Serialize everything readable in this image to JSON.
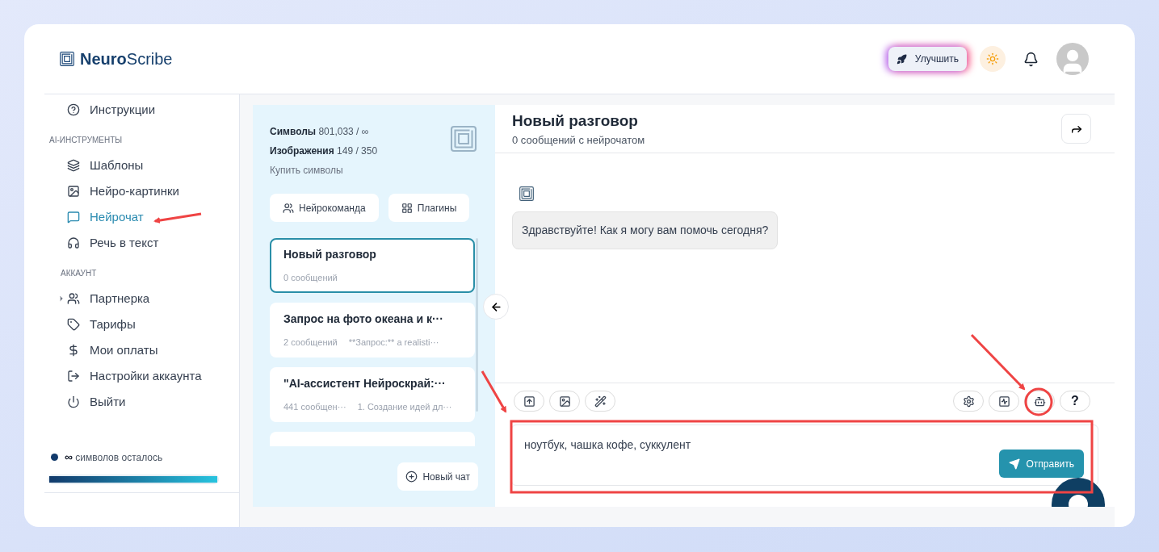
{
  "brand": {
    "bold": "Neuro",
    "light": "Scribe"
  },
  "topbar": {
    "upgrade": "Улучшить"
  },
  "sidebar": {
    "sections": [
      {
        "items": [
          {
            "kind": "link",
            "label": "Инструкции",
            "selected": false
          }
        ]
      },
      {
        "heading": "AI-ИНСТРУМЕНТЫ",
        "items": [
          {
            "kind": "link",
            "label": "Шаблоны",
            "selected": false
          },
          {
            "kind": "link",
            "label": "Нейро-картинки",
            "selected": false
          },
          {
            "kind": "link",
            "label": "Нейрочат",
            "selected": true
          },
          {
            "kind": "link",
            "label": "Речь в текст",
            "selected": false
          }
        ]
      },
      {
        "heading": "АККАУНТ",
        "items": [
          {
            "kind": "group",
            "label": "Партнерка",
            "selected": false,
            "expanded": false
          },
          {
            "kind": "link",
            "label": "Тарифы",
            "selected": false
          },
          {
            "kind": "link",
            "label": "Мои оплаты",
            "selected": false
          },
          {
            "kind": "link",
            "label": "Настройки аккаунта",
            "selected": false
          },
          {
            "kind": "link",
            "label": "Выйти",
            "selected": false
          }
        ]
      }
    ],
    "quota": {
      "symbol": "∞",
      "text": "символов осталось",
      "level": 1
    }
  },
  "chats_panel": {
    "stats": [
      {
        "label": "Символы",
        "value": "801,033 / ∞"
      },
      {
        "label": "Изображения",
        "value": "149 / 350"
      }
    ],
    "buy_link": "Купить символы",
    "buttons": [
      "Нейрокоманда",
      "Плагины"
    ],
    "chats": [
      {
        "title": "Новый разговор",
        "count": "0 сообщений",
        "selected": true
      },
      {
        "title": "Запрос на фото океана и к···",
        "count": "2 сообщений",
        "preview": "**Запрос:** a realisti···",
        "selected": false
      },
      {
        "title": "\"AI-ассистент Нейроскрай:···",
        "count": "441 сообщен···",
        "preview": "1. Создание идей дл···",
        "selected": false
      }
    ],
    "new_chat": "Новый чат"
  },
  "conversation": {
    "title": "Новый разговор",
    "subtitle": "0 сообщений с нейрочатом",
    "messages": [
      {
        "text": "Здравствуйте! Как я могу вам помочь сегодня?"
      }
    ],
    "help_button": "?",
    "input_value": "ноутбук, чашка кофе, суккулент",
    "send": "Отправить"
  }
}
